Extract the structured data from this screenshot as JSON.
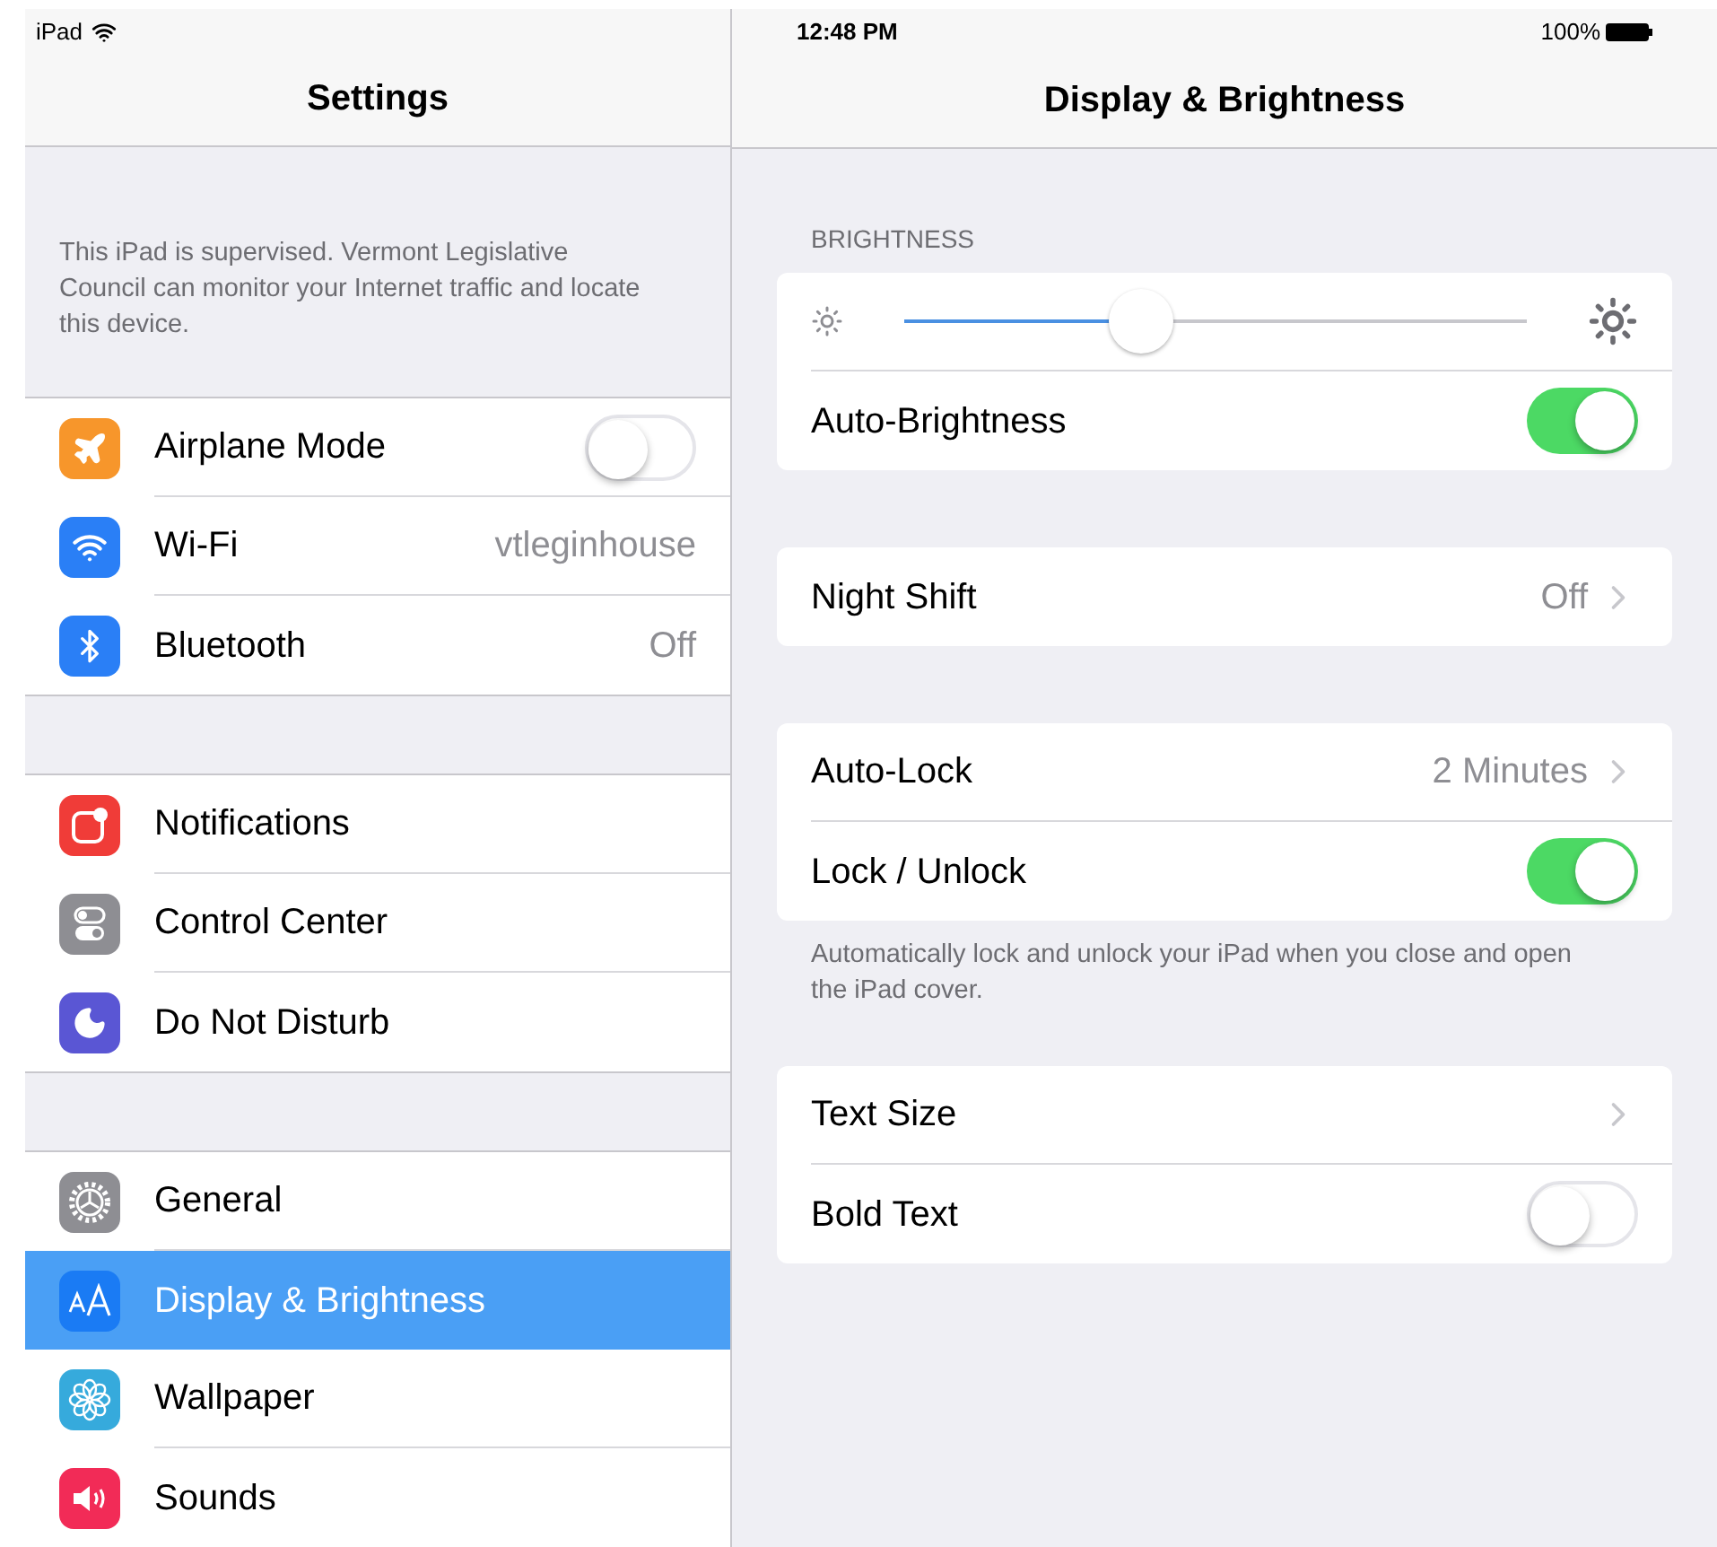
{
  "status_bar": {
    "device": "iPad",
    "time": "12:48 PM",
    "battery": "100%"
  },
  "sidebar": {
    "title": "Settings",
    "note": "This iPad is supervised. Vermont Legislative Council can monitor your Internet traffic and locate this device.",
    "groups": [
      [
        {
          "label": "Airplane Mode",
          "kind": "toggle",
          "on": false,
          "color": "#f7962b",
          "selected": false
        },
        {
          "label": "Wi-Fi",
          "kind": "value",
          "value": "vtleginhouse",
          "color": "#2a7ff6",
          "selected": false
        },
        {
          "label": "Bluetooth",
          "kind": "value",
          "value": "Off",
          "color": "#2a7ff6",
          "selected": false
        }
      ],
      [
        {
          "label": "Notifications",
          "kind": "nav",
          "color": "#f03c38",
          "selected": false
        },
        {
          "label": "Control Center",
          "kind": "nav",
          "color": "#8e8e93",
          "selected": false
        },
        {
          "label": "Do Not Disturb",
          "kind": "nav",
          "color": "#5a56d4",
          "selected": false
        }
      ],
      [
        {
          "label": "General",
          "kind": "nav",
          "color": "#8e8e93",
          "selected": false
        },
        {
          "label": "Display & Brightness",
          "kind": "nav",
          "color": "#1a7bf4",
          "selected": true
        },
        {
          "label": "Wallpaper",
          "kind": "nav",
          "color": "#36aadc",
          "selected": false
        },
        {
          "label": "Sounds",
          "kind": "nav",
          "color": "#f22b57",
          "selected": false
        }
      ]
    ]
  },
  "detail": {
    "title": "Display & Brightness",
    "sections": [
      {
        "header": "BRIGHTNESS",
        "rows": [
          {
            "kind": "slider",
            "level": 0.38
          },
          {
            "kind": "toggle",
            "label": "Auto-Brightness",
            "on": true
          }
        ]
      },
      {
        "rows": [
          {
            "kind": "value",
            "label": "Night Shift",
            "value": "Off"
          }
        ]
      },
      {
        "rows": [
          {
            "kind": "value",
            "label": "Auto-Lock",
            "value": "2 Minutes"
          },
          {
            "kind": "toggle",
            "label": "Lock / Unlock",
            "on": true
          }
        ],
        "footer": "Automatically lock and unlock your iPad when you close and open the iPad cover."
      },
      {
        "rows": [
          {
            "kind": "value",
            "label": "Text Size"
          },
          {
            "kind": "toggle",
            "label": "Bold Text",
            "on": false
          }
        ]
      }
    ]
  }
}
